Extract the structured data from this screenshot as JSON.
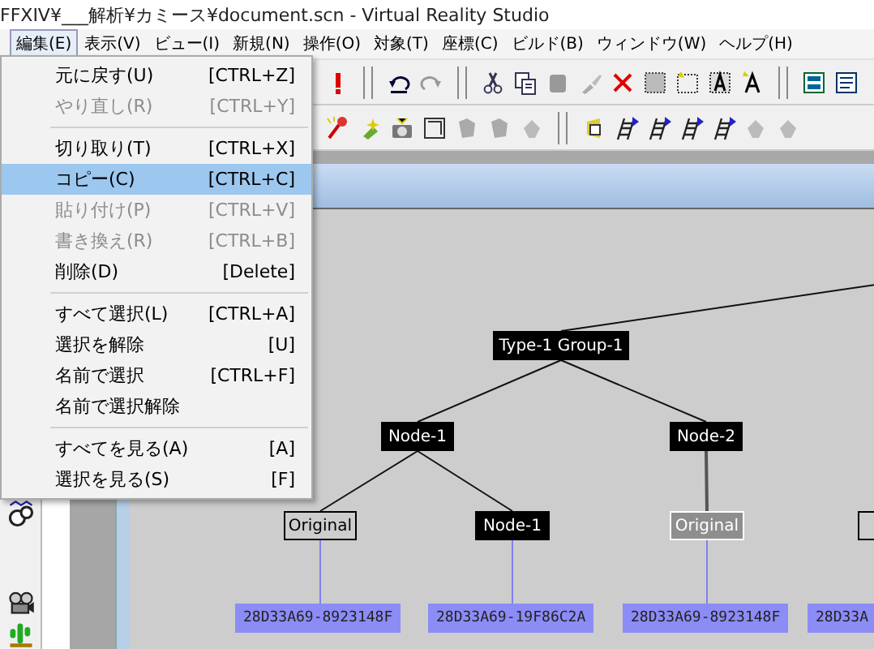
{
  "window": {
    "title": "FFXIV¥___解析¥カミース¥document.scn - Virtual Reality Studio"
  },
  "menu_bar": [
    {
      "label": "編集(E)",
      "selected": true
    },
    {
      "label": "表示(V)",
      "selected": false
    },
    {
      "label": "ビュー(I)",
      "selected": false
    },
    {
      "label": "新規(N)",
      "selected": false
    },
    {
      "label": "操作(O)",
      "selected": false
    },
    {
      "label": "対象(T)",
      "selected": false
    },
    {
      "label": "座標(C)",
      "selected": false
    },
    {
      "label": "ビルド(B)",
      "selected": false
    },
    {
      "label": "ウィンドウ(W)",
      "selected": false
    },
    {
      "label": "ヘルプ(H)",
      "selected": false
    }
  ],
  "edit_menu": {
    "items": [
      {
        "kind": "item",
        "label": "元に戻す(U)",
        "shortcut": "[CTRL+Z]",
        "disabled": false,
        "selected": false
      },
      {
        "kind": "item",
        "label": "やり直し(R)",
        "shortcut": "[CTRL+Y]",
        "disabled": true,
        "selected": false
      },
      {
        "kind": "separator"
      },
      {
        "kind": "item",
        "label": "切り取り(T)",
        "shortcut": "[CTRL+X]",
        "disabled": false,
        "selected": false
      },
      {
        "kind": "item",
        "label": "コピー(C)",
        "shortcut": "[CTRL+C]",
        "disabled": false,
        "selected": true
      },
      {
        "kind": "item",
        "label": "貼り付け(P)",
        "shortcut": "[CTRL+V]",
        "disabled": true,
        "selected": false
      },
      {
        "kind": "item",
        "label": "書き換え(R)",
        "shortcut": "[CTRL+B]",
        "disabled": true,
        "selected": false
      },
      {
        "kind": "item",
        "label": "削除(D)",
        "shortcut": "[Delete]",
        "disabled": false,
        "selected": false
      },
      {
        "kind": "separator"
      },
      {
        "kind": "item",
        "label": "すべて選択(L)",
        "shortcut": "[CTRL+A]",
        "disabled": false,
        "selected": false
      },
      {
        "kind": "item",
        "label": "選択を解除",
        "shortcut": "[U]",
        "disabled": false,
        "selected": false
      },
      {
        "kind": "item",
        "label": "名前で選択",
        "shortcut": "[CTRL+F]",
        "disabled": false,
        "selected": false
      },
      {
        "kind": "item",
        "label": "名前で選択解除",
        "disabled": false,
        "selected": false
      },
      {
        "kind": "separator"
      },
      {
        "kind": "item",
        "label": "すべてを見る(A)",
        "shortcut": "[A]",
        "disabled": false,
        "selected": false
      },
      {
        "kind": "item",
        "label": "選択を見る(S)",
        "shortcut": "[F]",
        "disabled": false,
        "selected": false
      }
    ]
  },
  "diagram": {
    "nodes": [
      {
        "kind": "filled",
        "label": "Type-1 Group-1"
      },
      {
        "kind": "filled",
        "label": "Node-1"
      },
      {
        "kind": "filled",
        "label": "Node-2"
      },
      {
        "kind": "outlined",
        "label": "Original"
      },
      {
        "kind": "filled",
        "label": "Node-1"
      },
      {
        "kind": "faded",
        "label": "Original"
      },
      {
        "kind": "outlined"
      }
    ],
    "ids": [
      "28D33A69-8923148F",
      "28D33A69-19F86C2A",
      "28D33A69-8923148F",
      "28D33A"
    ]
  }
}
